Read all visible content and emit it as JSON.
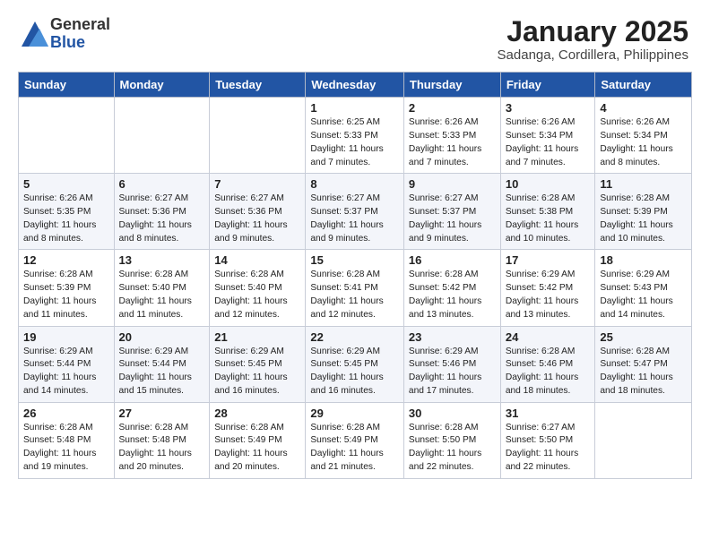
{
  "header": {
    "logo_general": "General",
    "logo_blue": "Blue",
    "month_title": "January 2025",
    "subtitle": "Sadanga, Cordillera, Philippines"
  },
  "days_of_week": [
    "Sunday",
    "Monday",
    "Tuesday",
    "Wednesday",
    "Thursday",
    "Friday",
    "Saturday"
  ],
  "weeks": [
    [
      {
        "day": "",
        "info": ""
      },
      {
        "day": "",
        "info": ""
      },
      {
        "day": "",
        "info": ""
      },
      {
        "day": "1",
        "info": "Sunrise: 6:25 AM\nSunset: 5:33 PM\nDaylight: 11 hours\nand 7 minutes."
      },
      {
        "day": "2",
        "info": "Sunrise: 6:26 AM\nSunset: 5:33 PM\nDaylight: 11 hours\nand 7 minutes."
      },
      {
        "day": "3",
        "info": "Sunrise: 6:26 AM\nSunset: 5:34 PM\nDaylight: 11 hours\nand 7 minutes."
      },
      {
        "day": "4",
        "info": "Sunrise: 6:26 AM\nSunset: 5:34 PM\nDaylight: 11 hours\nand 8 minutes."
      }
    ],
    [
      {
        "day": "5",
        "info": "Sunrise: 6:26 AM\nSunset: 5:35 PM\nDaylight: 11 hours\nand 8 minutes."
      },
      {
        "day": "6",
        "info": "Sunrise: 6:27 AM\nSunset: 5:36 PM\nDaylight: 11 hours\nand 8 minutes."
      },
      {
        "day": "7",
        "info": "Sunrise: 6:27 AM\nSunset: 5:36 PM\nDaylight: 11 hours\nand 9 minutes."
      },
      {
        "day": "8",
        "info": "Sunrise: 6:27 AM\nSunset: 5:37 PM\nDaylight: 11 hours\nand 9 minutes."
      },
      {
        "day": "9",
        "info": "Sunrise: 6:27 AM\nSunset: 5:37 PM\nDaylight: 11 hours\nand 9 minutes."
      },
      {
        "day": "10",
        "info": "Sunrise: 6:28 AM\nSunset: 5:38 PM\nDaylight: 11 hours\nand 10 minutes."
      },
      {
        "day": "11",
        "info": "Sunrise: 6:28 AM\nSunset: 5:39 PM\nDaylight: 11 hours\nand 10 minutes."
      }
    ],
    [
      {
        "day": "12",
        "info": "Sunrise: 6:28 AM\nSunset: 5:39 PM\nDaylight: 11 hours\nand 11 minutes."
      },
      {
        "day": "13",
        "info": "Sunrise: 6:28 AM\nSunset: 5:40 PM\nDaylight: 11 hours\nand 11 minutes."
      },
      {
        "day": "14",
        "info": "Sunrise: 6:28 AM\nSunset: 5:40 PM\nDaylight: 11 hours\nand 12 minutes."
      },
      {
        "day": "15",
        "info": "Sunrise: 6:28 AM\nSunset: 5:41 PM\nDaylight: 11 hours\nand 12 minutes."
      },
      {
        "day": "16",
        "info": "Sunrise: 6:28 AM\nSunset: 5:42 PM\nDaylight: 11 hours\nand 13 minutes."
      },
      {
        "day": "17",
        "info": "Sunrise: 6:29 AM\nSunset: 5:42 PM\nDaylight: 11 hours\nand 13 minutes."
      },
      {
        "day": "18",
        "info": "Sunrise: 6:29 AM\nSunset: 5:43 PM\nDaylight: 11 hours\nand 14 minutes."
      }
    ],
    [
      {
        "day": "19",
        "info": "Sunrise: 6:29 AM\nSunset: 5:44 PM\nDaylight: 11 hours\nand 14 minutes."
      },
      {
        "day": "20",
        "info": "Sunrise: 6:29 AM\nSunset: 5:44 PM\nDaylight: 11 hours\nand 15 minutes."
      },
      {
        "day": "21",
        "info": "Sunrise: 6:29 AM\nSunset: 5:45 PM\nDaylight: 11 hours\nand 16 minutes."
      },
      {
        "day": "22",
        "info": "Sunrise: 6:29 AM\nSunset: 5:45 PM\nDaylight: 11 hours\nand 16 minutes."
      },
      {
        "day": "23",
        "info": "Sunrise: 6:29 AM\nSunset: 5:46 PM\nDaylight: 11 hours\nand 17 minutes."
      },
      {
        "day": "24",
        "info": "Sunrise: 6:28 AM\nSunset: 5:46 PM\nDaylight: 11 hours\nand 18 minutes."
      },
      {
        "day": "25",
        "info": "Sunrise: 6:28 AM\nSunset: 5:47 PM\nDaylight: 11 hours\nand 18 minutes."
      }
    ],
    [
      {
        "day": "26",
        "info": "Sunrise: 6:28 AM\nSunset: 5:48 PM\nDaylight: 11 hours\nand 19 minutes."
      },
      {
        "day": "27",
        "info": "Sunrise: 6:28 AM\nSunset: 5:48 PM\nDaylight: 11 hours\nand 20 minutes."
      },
      {
        "day": "28",
        "info": "Sunrise: 6:28 AM\nSunset: 5:49 PM\nDaylight: 11 hours\nand 20 minutes."
      },
      {
        "day": "29",
        "info": "Sunrise: 6:28 AM\nSunset: 5:49 PM\nDaylight: 11 hours\nand 21 minutes."
      },
      {
        "day": "30",
        "info": "Sunrise: 6:28 AM\nSunset: 5:50 PM\nDaylight: 11 hours\nand 22 minutes."
      },
      {
        "day": "31",
        "info": "Sunrise: 6:27 AM\nSunset: 5:50 PM\nDaylight: 11 hours\nand 22 minutes."
      },
      {
        "day": "",
        "info": ""
      }
    ]
  ]
}
